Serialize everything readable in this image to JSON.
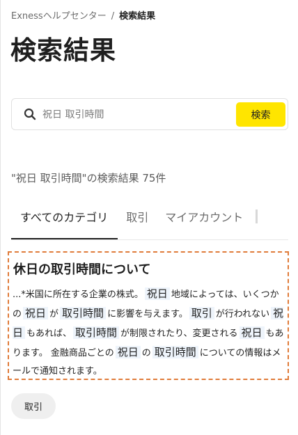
{
  "breadcrumb": {
    "home": "Exnessヘルプセンター",
    "separator": "/",
    "current": "検索結果"
  },
  "page_title": "検索結果",
  "search": {
    "placeholder": "祝日 取引時間",
    "button_label": "検索"
  },
  "results_summary": "\"祝日 取引時間\"の検索結果 75件",
  "tabs": [
    {
      "label": "すべてのカテゴリ",
      "active": true
    },
    {
      "label": "取引",
      "active": false
    },
    {
      "label": "マイアカウント",
      "active": false
    }
  ],
  "result": {
    "title": "休日の取引時間について",
    "snippet": [
      {
        "text": "...*米国に所在する企業の株式。"
      },
      {
        "text": "祝日",
        "hl": true
      },
      {
        "text": "地域によっては、いくつかの"
      },
      {
        "text": "祝日",
        "hl": true
      },
      {
        "text": "が"
      },
      {
        "text": "取引時間",
        "hl": true
      },
      {
        "text": "に影響を与えます。"
      },
      {
        "text": "取引",
        "hl": true
      },
      {
        "text": "が行われない"
      },
      {
        "text": "祝日",
        "hl": true
      },
      {
        "text": "もあれば、"
      },
      {
        "text": "取引時間",
        "hl": true
      },
      {
        "text": "が制限されたり、変更される"
      },
      {
        "text": "祝日",
        "hl": true
      },
      {
        "text": "もあります。 金融商品ごとの"
      },
      {
        "text": "祝日",
        "hl": true
      },
      {
        "text": "の"
      },
      {
        "text": "取引時間",
        "hl": true
      },
      {
        "text": "についての情報はメールで通知されます。"
      }
    ]
  },
  "tag": "取引",
  "colors": {
    "accent_yellow": "#ffe500",
    "highlight_bg": "#eef4fb",
    "card_border": "#e07b39"
  }
}
